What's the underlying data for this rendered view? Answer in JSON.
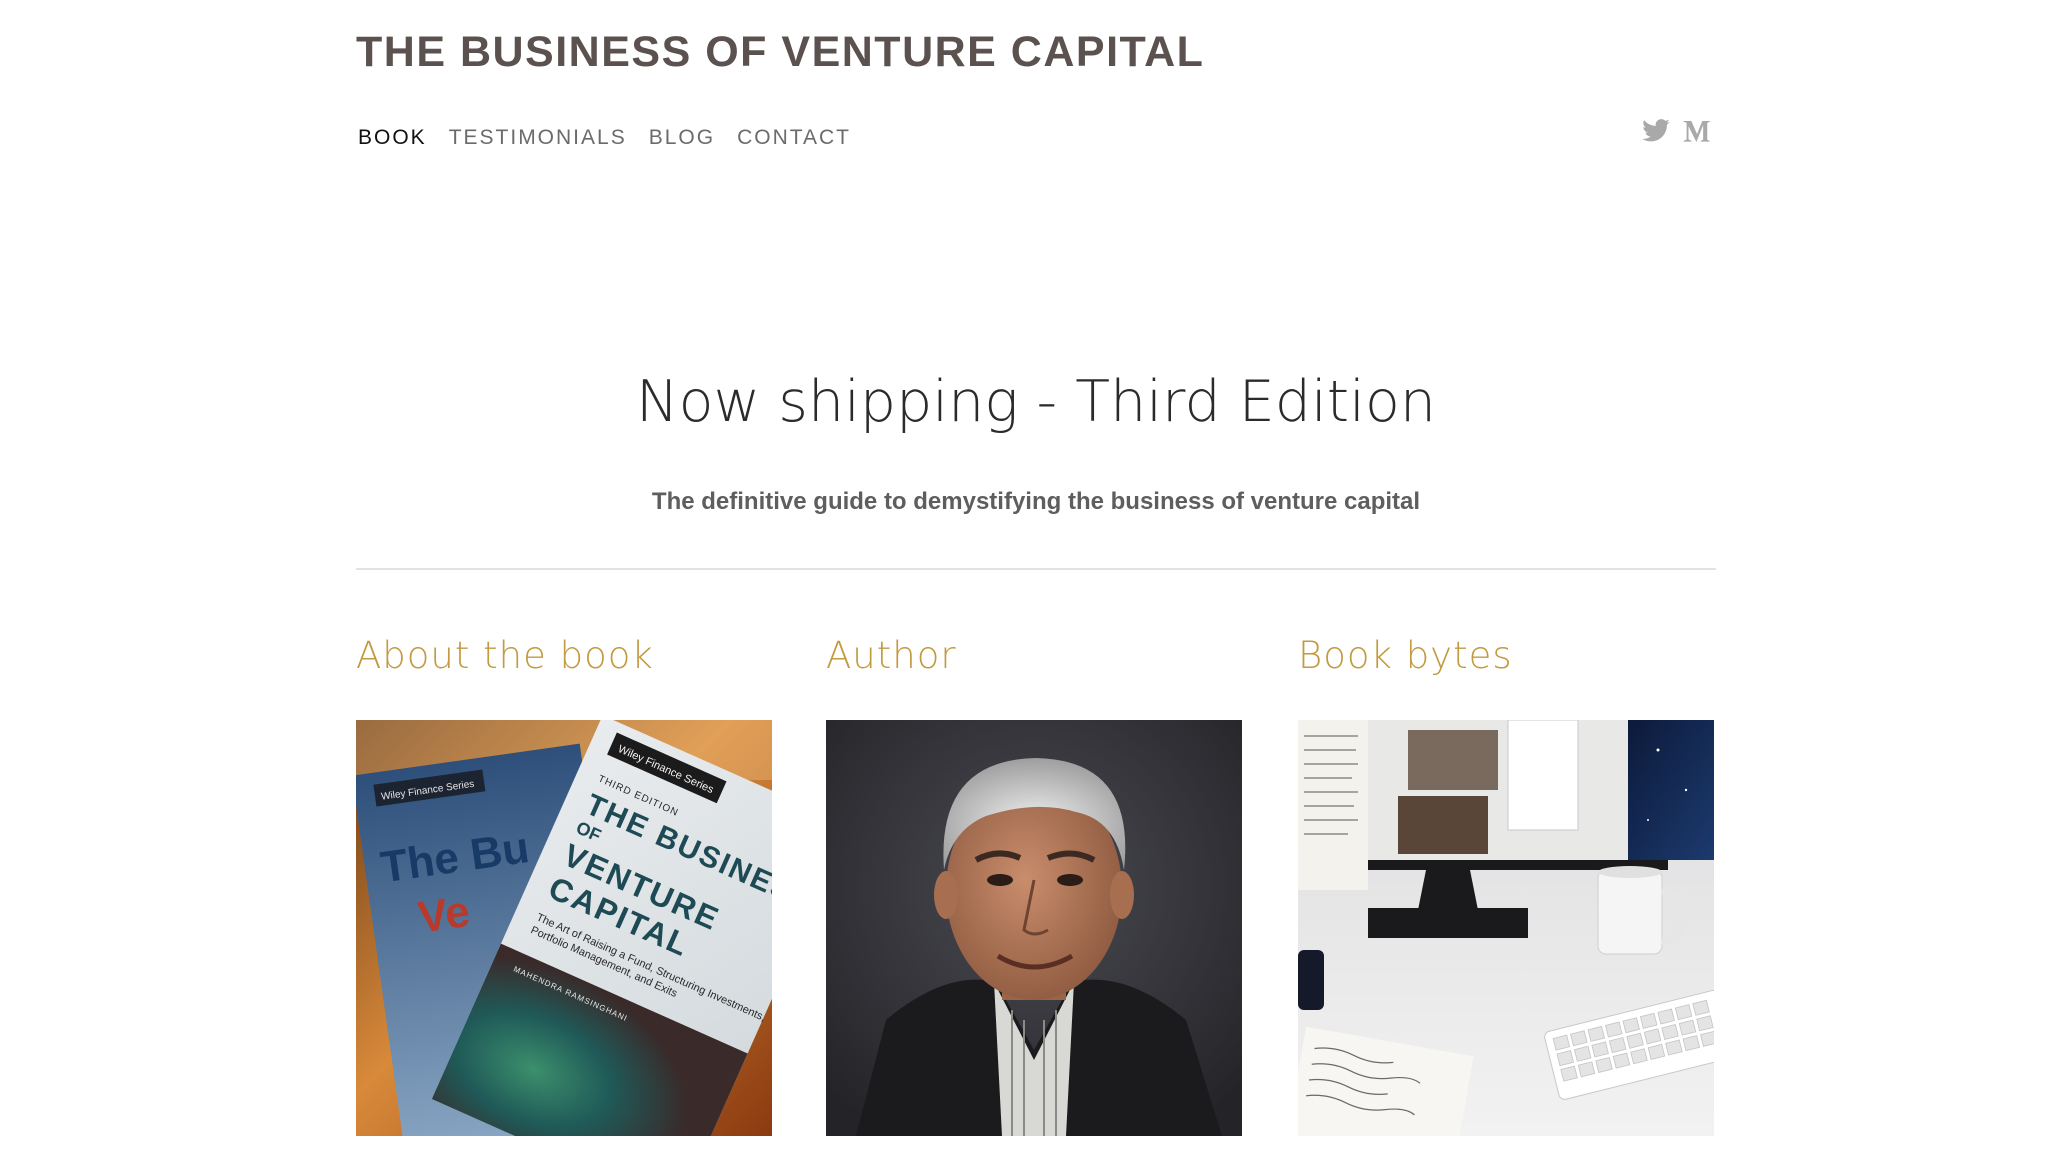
{
  "header": {
    "site_title": "THE BUSINESS OF VENTURE CAPITAL",
    "nav": [
      {
        "label": "BOOK",
        "active": true
      },
      {
        "label": "TESTIMONIALS",
        "active": false
      },
      {
        "label": "BLOG",
        "active": false
      },
      {
        "label": "CONTACT",
        "active": false
      }
    ],
    "social_icons": [
      "twitter-icon",
      "medium-icon"
    ]
  },
  "hero": {
    "title": "Now shipping - Third Edition",
    "subtitle": "The definitive guide to demystifying the business of venture capital"
  },
  "columns": [
    {
      "heading": "About the book",
      "image": "book-cover-photo"
    },
    {
      "heading": "Author",
      "image": "author-portrait-photo"
    },
    {
      "heading": "Book bytes",
      "image": "desk-workspace-photo"
    }
  ],
  "colors": {
    "title": "#5b524f",
    "nav_active": "#111111",
    "nav": "#6b6b6b",
    "accent_heading": "#c29a40",
    "divider": "#e2e2e2"
  }
}
